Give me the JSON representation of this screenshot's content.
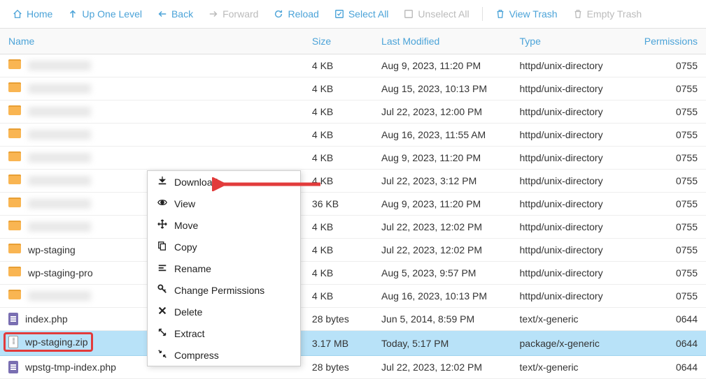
{
  "toolbar": {
    "home": "Home",
    "up": "Up One Level",
    "back": "Back",
    "forward": "Forward",
    "reload": "Reload",
    "select_all": "Select All",
    "unselect_all": "Unselect All",
    "view_trash": "View Trash",
    "empty_trash": "Empty Trash"
  },
  "columns": {
    "name": "Name",
    "size": "Size",
    "last_modified": "Last Modified",
    "type": "Type",
    "permissions": "Permissions"
  },
  "rows": [
    {
      "name": "",
      "blurred": true,
      "icon": "folder",
      "size": "4 KB",
      "modified": "Aug 9, 2023, 11:20 PM",
      "type": "httpd/unix-directory",
      "perm": "0755"
    },
    {
      "name": "",
      "blurred": true,
      "icon": "folder",
      "size": "4 KB",
      "modified": "Aug 15, 2023, 10:13 PM",
      "type": "httpd/unix-directory",
      "perm": "0755"
    },
    {
      "name": "",
      "blurred": true,
      "icon": "folder",
      "size": "4 KB",
      "modified": "Jul 22, 2023, 12:00 PM",
      "type": "httpd/unix-directory",
      "perm": "0755"
    },
    {
      "name": "",
      "blurred": true,
      "icon": "folder",
      "size": "4 KB",
      "modified": "Aug 16, 2023, 11:55 AM",
      "type": "httpd/unix-directory",
      "perm": "0755"
    },
    {
      "name": "",
      "blurred": true,
      "icon": "folder",
      "size": "4 KB",
      "modified": "Aug 9, 2023, 11:20 PM",
      "type": "httpd/unix-directory",
      "perm": "0755"
    },
    {
      "name": "",
      "blurred": true,
      "icon": "folder",
      "size": "4 KB",
      "modified": "Jul 22, 2023, 3:12 PM",
      "type": "httpd/unix-directory",
      "perm": "0755"
    },
    {
      "name": "",
      "blurred": true,
      "icon": "folder",
      "size": "36 KB",
      "modified": "Aug 9, 2023, 11:20 PM",
      "type": "httpd/unix-directory",
      "perm": "0755"
    },
    {
      "name": "",
      "blurred": true,
      "icon": "folder",
      "size": "4 KB",
      "modified": "Jul 22, 2023, 12:02 PM",
      "type": "httpd/unix-directory",
      "perm": "0755"
    },
    {
      "name": "wp-staging",
      "icon": "folder",
      "size": "4 KB",
      "modified": "Jul 22, 2023, 12:02 PM",
      "type": "httpd/unix-directory",
      "perm": "0755"
    },
    {
      "name": "wp-staging-pro",
      "icon": "folder",
      "size": "4 KB",
      "modified": "Aug 5, 2023, 9:57 PM",
      "type": "httpd/unix-directory",
      "perm": "0755"
    },
    {
      "name": "",
      "blurred": true,
      "icon": "folder",
      "size": "4 KB",
      "modified": "Aug 16, 2023, 10:13 PM",
      "type": "httpd/unix-directory",
      "perm": "0755"
    },
    {
      "name": "index.php",
      "icon": "php",
      "size": "28 bytes",
      "modified": "Jun 5, 2014, 8:59 PM",
      "type": "text/x-generic",
      "perm": "0644"
    },
    {
      "name": "wp-staging.zip",
      "icon": "zip",
      "size": "3.17 MB",
      "modified": "Today, 5:17 PM",
      "type": "package/x-generic",
      "perm": "0644",
      "selected": true,
      "highlighted": true
    },
    {
      "name": "wpstg-tmp-index.php",
      "icon": "php",
      "size": "28 bytes",
      "modified": "Jul 22, 2023, 12:02 PM",
      "type": "text/x-generic",
      "perm": "0644"
    }
  ],
  "context_menu": {
    "download": "Download",
    "view": "View",
    "move": "Move",
    "copy": "Copy",
    "rename": "Rename",
    "change_permissions": "Change Permissions",
    "delete": "Delete",
    "extract": "Extract",
    "compress": "Compress"
  }
}
